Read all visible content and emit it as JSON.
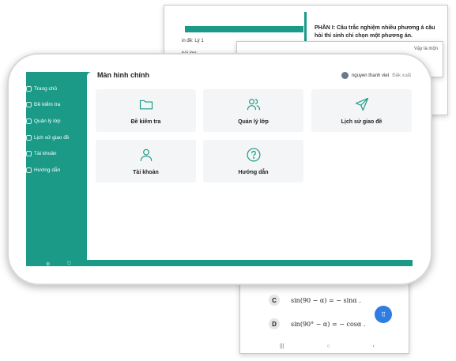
{
  "background_docs": {
    "top_left_line1": "in đề: Lý 1",
    "top_left_line2": "hỏi lớp:",
    "top_right_heading": "PHẦN I: Câu trắc nghiệm nhiều phương á câu hỏi thí sinh chỉ chọn một phương án.",
    "right_snippet": "Vậy là mộn",
    "options": [
      {
        "letter": "C",
        "text": "sin(90 − α) = − sinα ."
      },
      {
        "letter": "D",
        "text": "sin(90° − α) = − cosα ."
      }
    ]
  },
  "app": {
    "page_title": "Màn hình chính",
    "user_name": "nguyen thanh viet",
    "user_extra": "Đăk xuất",
    "accent_color": "#1a9a87",
    "sidebar": {
      "items": [
        {
          "label": "Trang chủ",
          "icon": "home-icon"
        },
        {
          "label": "Đề kiểm tra",
          "icon": "document-icon"
        },
        {
          "label": "Quản lý lớp",
          "icon": "class-icon"
        },
        {
          "label": "Lịch sử giao đề",
          "icon": "history-icon"
        },
        {
          "label": "Tài khoản",
          "icon": "account-icon"
        },
        {
          "label": "Hướng dẫn",
          "icon": "help-icon"
        }
      ]
    },
    "cards": [
      {
        "label": "Đề kiểm tra",
        "icon": "folder-icon"
      },
      {
        "label": "Quản lý lớp",
        "icon": "users-icon"
      },
      {
        "label": "Lịch sử giao đề",
        "icon": "send-icon"
      },
      {
        "label": "Tài khoản",
        "icon": "user-icon"
      },
      {
        "label": "Hướng dẫn",
        "icon": "help-circle-icon"
      }
    ]
  }
}
